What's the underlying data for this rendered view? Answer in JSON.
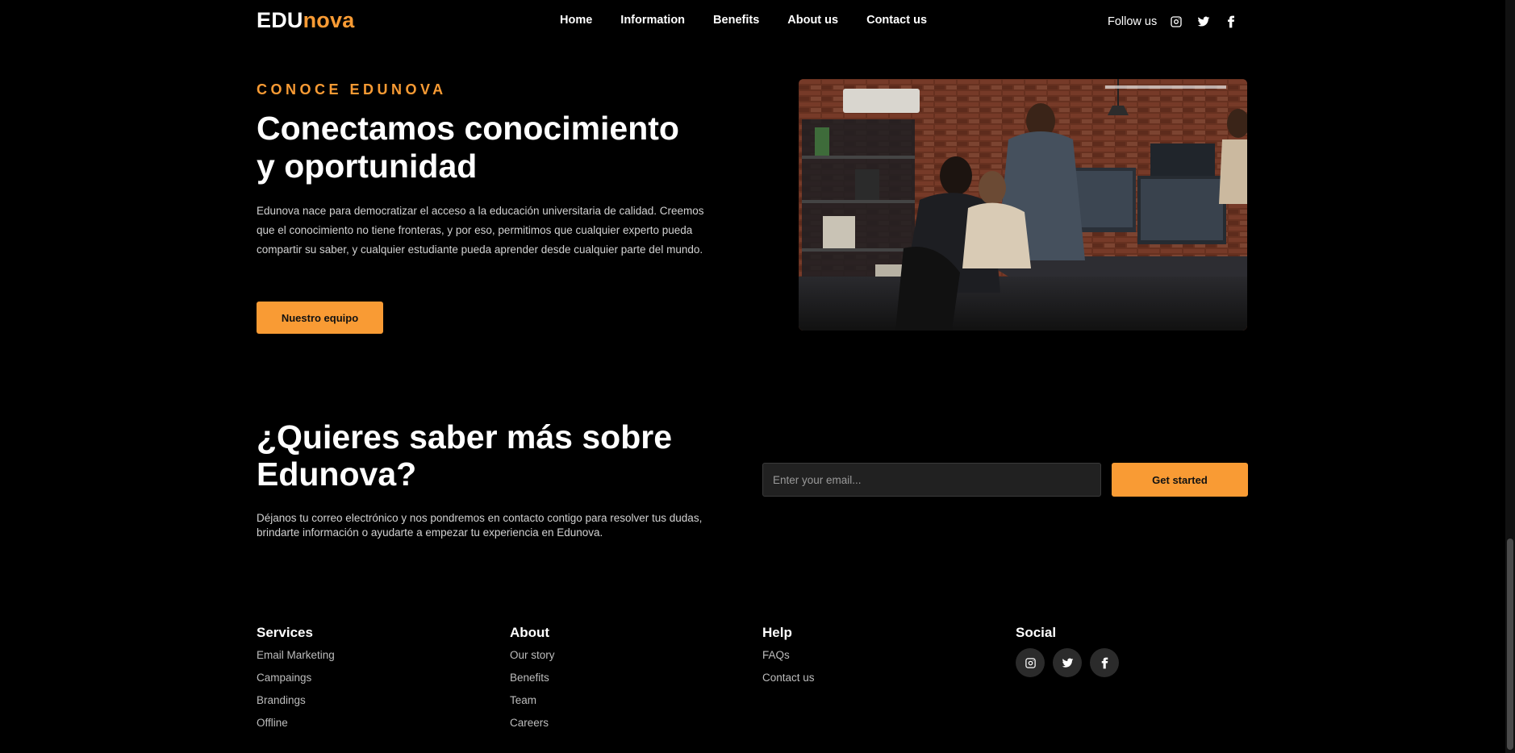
{
  "header": {
    "logo_prefix": "EDU",
    "logo_suffix": "nova",
    "nav": [
      "Home",
      "Information",
      "Benefits",
      "About us",
      "Contact us"
    ],
    "follow_label": "Follow us",
    "social_icons": [
      "instagram-icon",
      "twitter-icon",
      "facebook-icon"
    ]
  },
  "hero": {
    "eyebrow": "CONOCE EDUNOVA",
    "title_line1": "Conectamos conocimiento",
    "title_line2": "y oportunidad",
    "description": "Edunova nace para democratizar el acceso a la educación universitaria de calidad. Creemos que el conocimiento no tiene fronteras, y por eso, permitimos que cualquier experto pueda compartir su saber, y cualquier estudiante pueda aprender desde cualquier parte del mundo.",
    "button": "Nuestro equipo"
  },
  "cta": {
    "title_line1": "¿Quieres saber más sobre",
    "title_line2": "Edunova?",
    "description": "Déjanos tu correo electrónico y nos pondremos en contacto contigo para resolver tus dudas, brindarte información o ayudarte a empezar tu experiencia en Edunova.",
    "email_placeholder": "Enter your email...",
    "button": "Get started"
  },
  "footer": {
    "services": {
      "title": "Services",
      "items": [
        "Email Marketing",
        "Campaings",
        "Brandings",
        "Offline"
      ]
    },
    "about": {
      "title": "About",
      "items": [
        "Our story",
        "Benefits",
        "Team",
        "Careers"
      ]
    },
    "help": {
      "title": "Help",
      "items": [
        "FAQs",
        "Contact us"
      ]
    },
    "social": {
      "title": "Social",
      "icons": [
        "instagram-icon",
        "twitter-icon",
        "facebook-icon"
      ]
    }
  },
  "colors": {
    "accent": "#f99b34",
    "background": "#000000",
    "input_bg": "#212121",
    "social_circle": "#2b2b2b"
  }
}
